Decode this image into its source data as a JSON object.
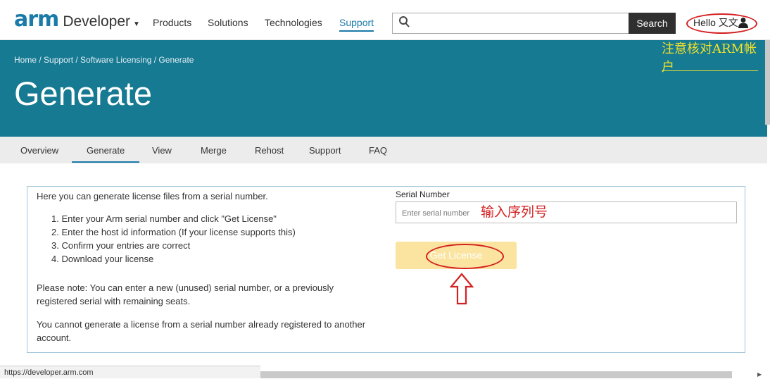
{
  "header": {
    "logo_brand": "arm",
    "logo_product": "Developer",
    "nav": [
      "Products",
      "Solutions",
      "Technologies",
      "Support"
    ],
    "active_nav": "Support",
    "search_placeholder": "",
    "search_button": "Search",
    "greeting": "Hello 又文"
  },
  "banner": {
    "breadcrumb": "Home  /  Support  /  Software Licensing  /  Generate",
    "title": "Generate",
    "annotation_account": "注意核对ARM帐户"
  },
  "tabs": [
    "Overview",
    "Generate",
    "View",
    "Merge",
    "Rehost",
    "Support",
    "FAQ"
  ],
  "active_tab": "Generate",
  "content": {
    "intro": "Here you can generate license files from a serial number.",
    "steps": [
      "1. Enter your Arm serial number and click \"Get License\"",
      "2. Enter the host id information (If your license supports this)",
      "3. Confirm your entries are correct",
      "4. Download your license"
    ],
    "note": "Please note: You can enter a new (unused) serial number, or a previously registered serial with remaining seats.",
    "cannot": "You cannot generate a license from a serial number already registered to another account.",
    "serial_label": "Serial Number",
    "serial_placeholder": "Enter serial number",
    "annotation_serial": "输入序列号",
    "get_license_button": "Get License"
  },
  "statusbar": {
    "url": "https://developer.arm.com"
  },
  "colors": {
    "brand": "#1a7aa8",
    "banner": "#167a93",
    "annotation_red": "#d42020",
    "annotation_yellow": "#f2e12a",
    "button_disabled": "#fae4a0"
  },
  "icons": [
    "search-icon",
    "user-icon",
    "caret-down-icon",
    "up-arrow-annotation-icon"
  ]
}
